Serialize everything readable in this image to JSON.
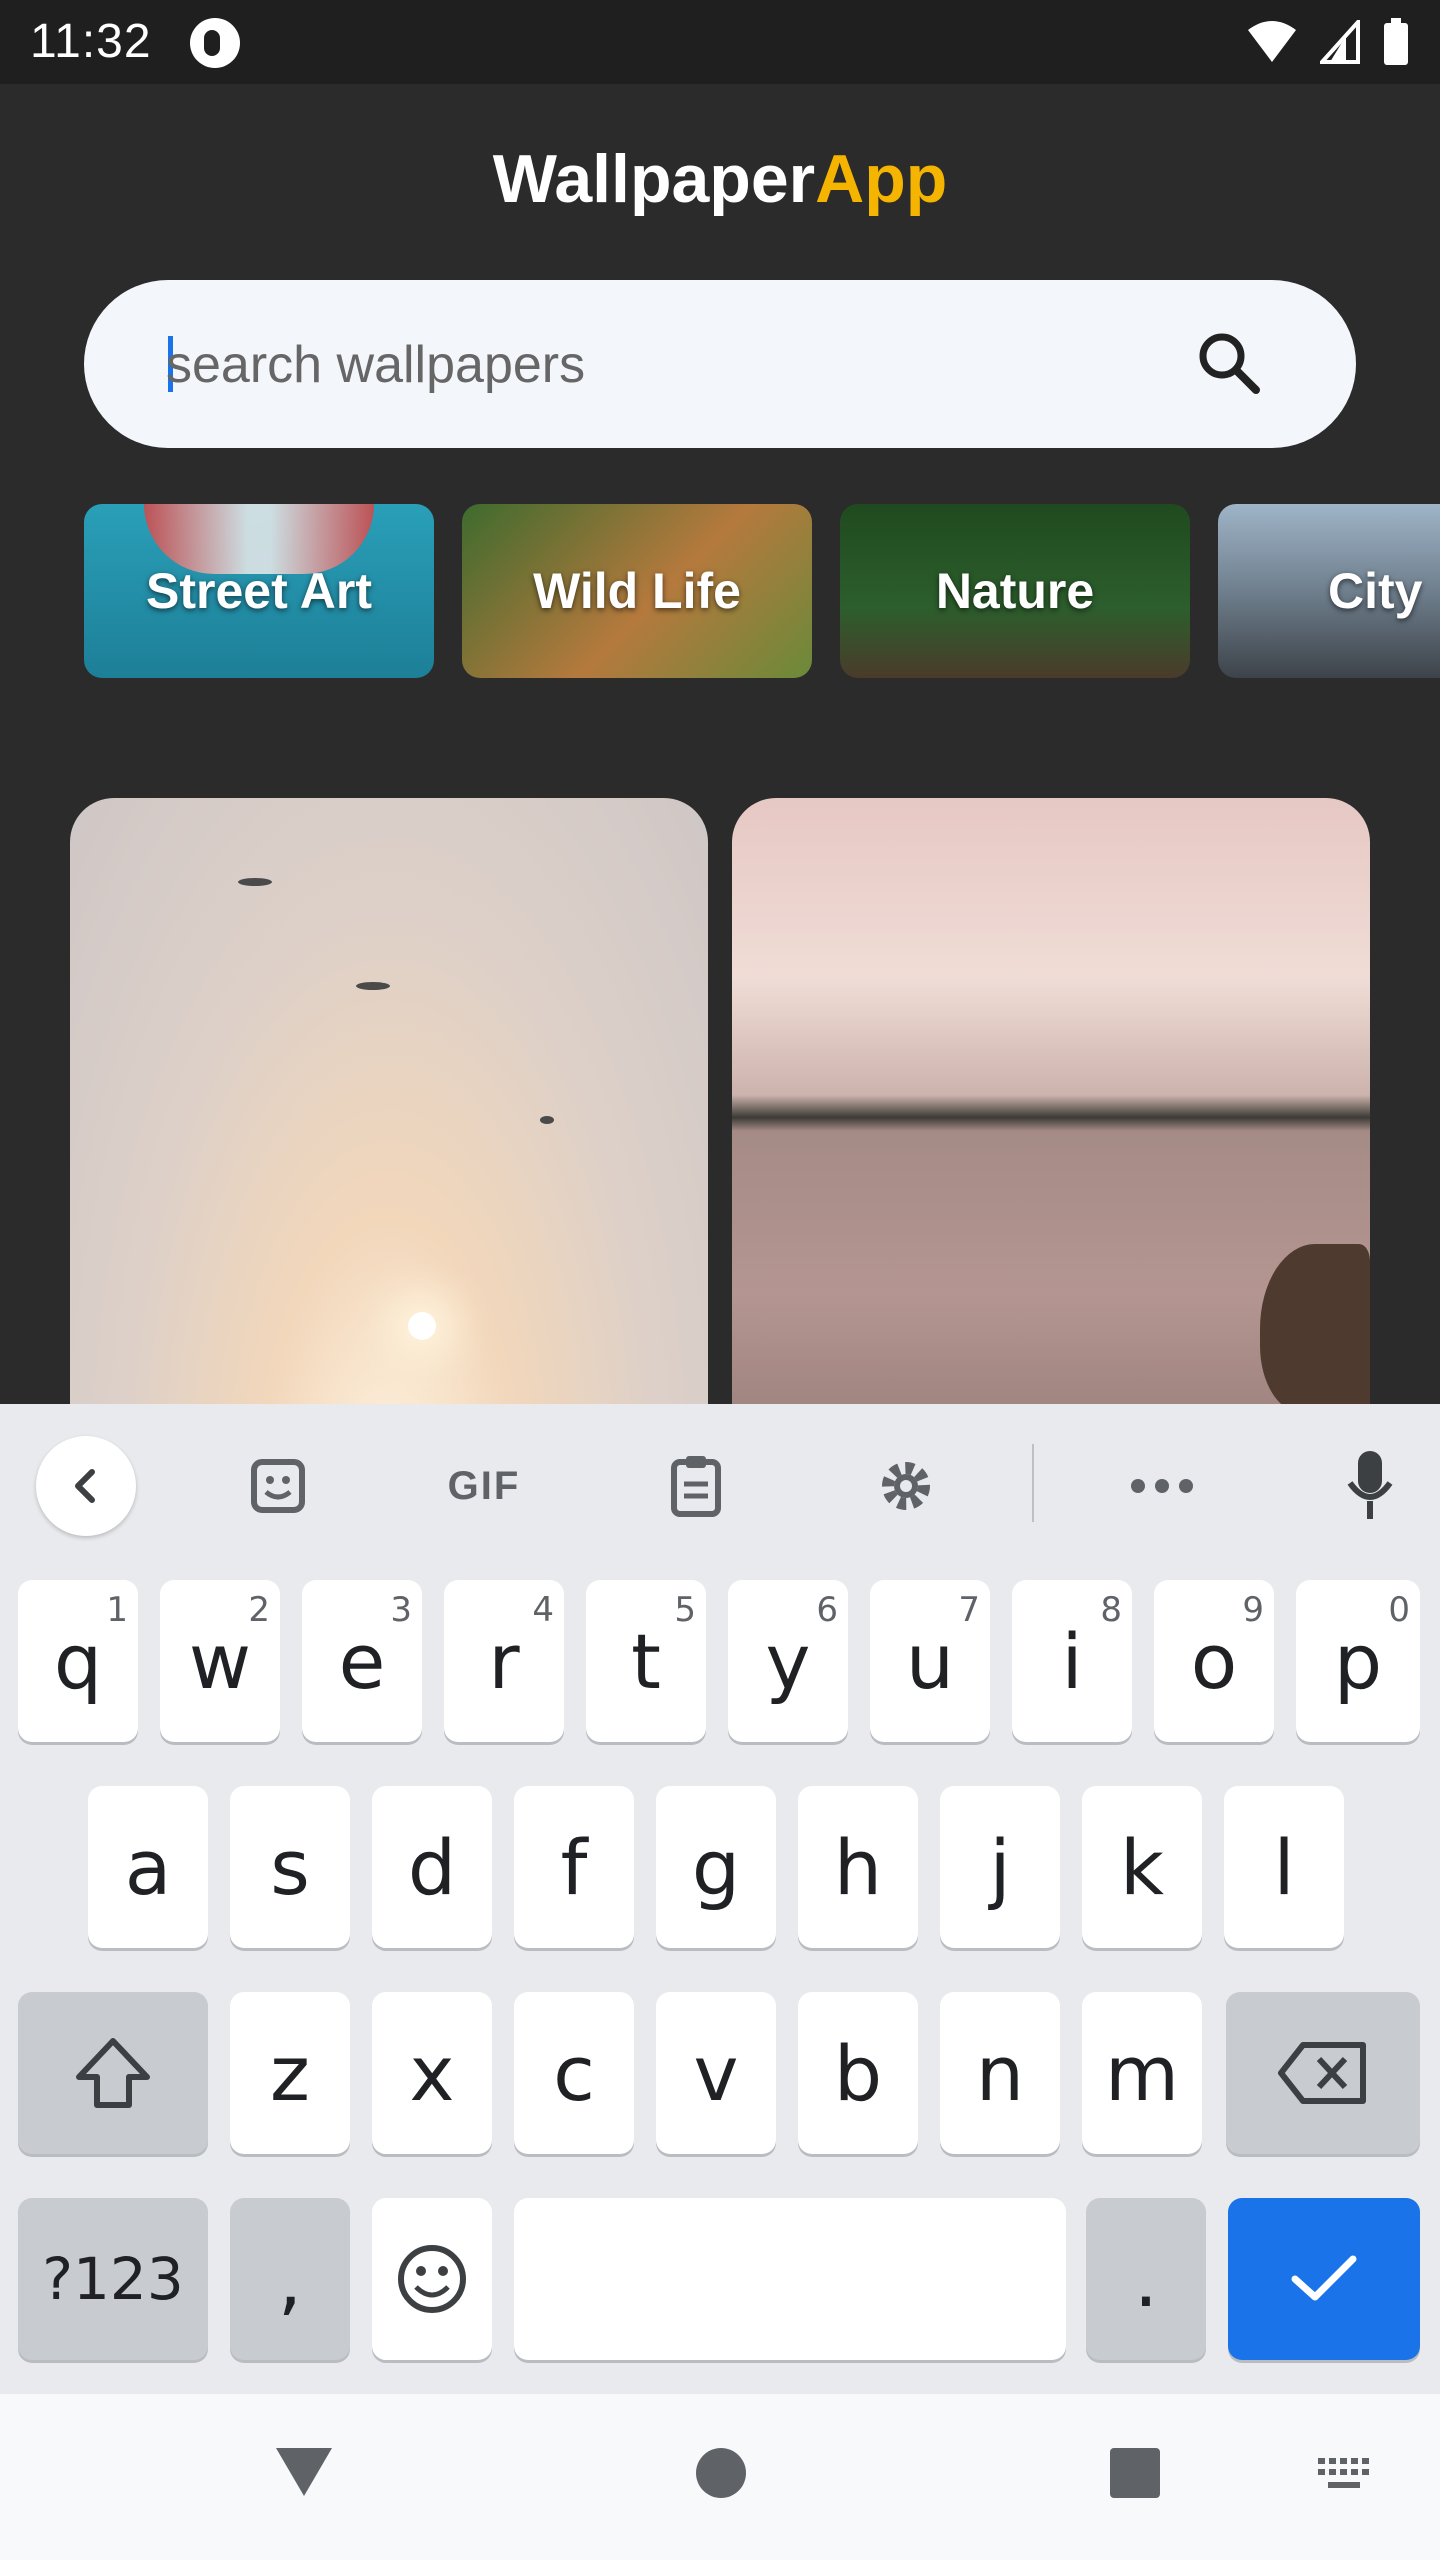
{
  "status_bar": {
    "time": "11:32"
  },
  "app": {
    "title_main": "Wallpaper",
    "title_accent": "App",
    "accent_color": "#f5b400"
  },
  "search": {
    "placeholder": "search wallpapers",
    "value": ""
  },
  "categories": [
    "Street Art",
    "Wild Life",
    "Nature",
    "City"
  ],
  "keyboard": {
    "toolbar": [
      "back-icon",
      "sticker-icon",
      "GIF",
      "clipboard-icon",
      "settings-icon",
      "more-icon",
      "mic-icon"
    ],
    "gif_label": "GIF",
    "row1": [
      "q",
      "w",
      "e",
      "r",
      "t",
      "y",
      "u",
      "i",
      "o",
      "p"
    ],
    "row1_hints": [
      "1",
      "2",
      "3",
      "4",
      "5",
      "6",
      "7",
      "8",
      "9",
      "0"
    ],
    "row2": [
      "a",
      "s",
      "d",
      "f",
      "g",
      "h",
      "j",
      "k",
      "l"
    ],
    "row3": [
      "z",
      "x",
      "c",
      "v",
      "b",
      "n",
      "m"
    ],
    "symbols_label": "?123",
    "comma": ",",
    "period": ".",
    "enter_color": "#1a73e8"
  },
  "nav_bar": [
    "back-triangle-icon",
    "home-circle-icon",
    "recents-square-icon",
    "keyboard-switch-icon"
  ]
}
